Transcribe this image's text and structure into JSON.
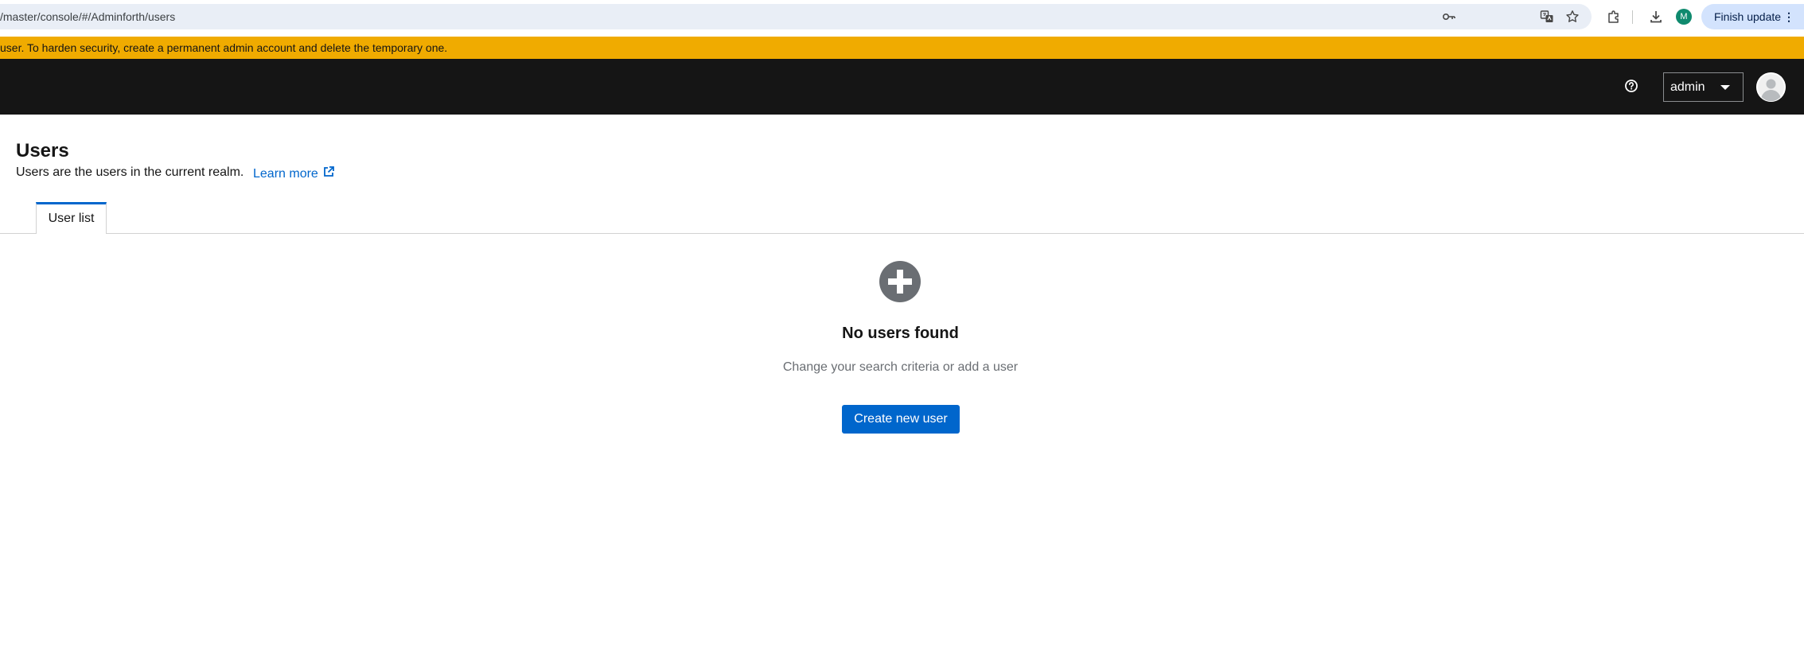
{
  "browser": {
    "url": "/master/console/#/Adminforth/users",
    "profile_initial": "M",
    "finish_update_label": "Finish update",
    "menu_glyph": "⋮",
    "icons": [
      "password-key-icon",
      "translate-icon",
      "bookmark-star-icon",
      "extensions-icon",
      "download-icon"
    ]
  },
  "banner": {
    "text": "user. To harden security, create a permanent admin account and delete the temporary one.",
    "color": "#f0ab00"
  },
  "masthead": {
    "background": "#151515",
    "username": "admin",
    "icons": [
      "help-icon",
      "avatar"
    ]
  },
  "page": {
    "title": "Users",
    "description": "Users are the users in the current realm.",
    "learn_more": "Learn more"
  },
  "tabs": [
    {
      "label": "User list",
      "active": true
    }
  ],
  "empty_state": {
    "icon": "plus-circle-icon",
    "title": "No users found",
    "body": "Change your search criteria or add a user",
    "action_label": "Create new user",
    "accent": "#0066cc"
  }
}
